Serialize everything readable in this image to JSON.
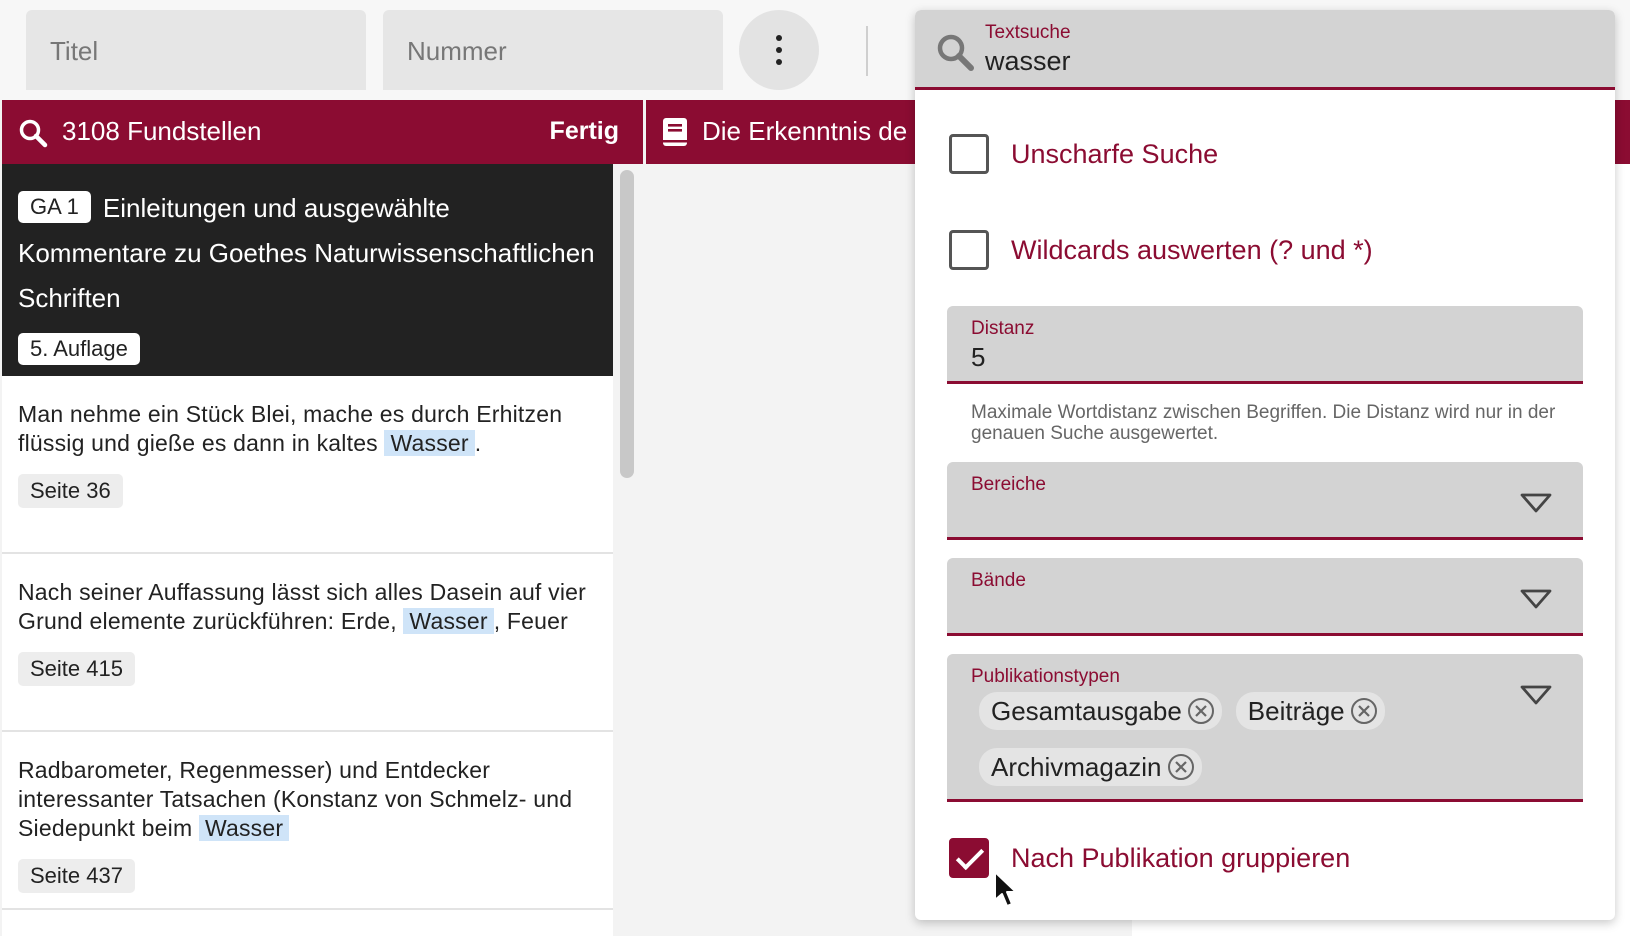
{
  "topbar": {
    "title_placeholder": "Titel",
    "number_placeholder": "Nummer"
  },
  "results_header": {
    "count": "3108 Fundstellen",
    "done_label": "Fertig"
  },
  "document_header": {
    "title": "Die Erkenntnis de"
  },
  "group": {
    "badge": "GA 1",
    "title": "Einleitungen und ausgewählte Kommentare zu Goethes Naturwissenschaftlichen Schriften",
    "edition": "5. Auflage"
  },
  "hits": [
    {
      "before": "Man nehme ein Stück Blei, mache es durch Erhitzen flüssig und gieße es dann in kaltes ",
      "match": "Wasser",
      "after": ".",
      "page": "Seite 36"
    },
    {
      "before": "Nach seiner Auffassung lässt sich alles Dasein auf vier Grund elemente zurückführen: Erde, ",
      "match": "Wasser",
      "after": ", Feuer",
      "page": "Seite 415"
    },
    {
      "before": "Radbarometer, Regenmesser) und Entdecker interessanter Tatsachen (Konstanz von Schmelz- und Siedepunkt beim ",
      "match": "Wasser",
      "after": "",
      "page": "Seite 437"
    }
  ],
  "search_panel": {
    "search_label": "Textsuche",
    "search_value": "wasser",
    "fuzzy": {
      "label": "Unscharfe Suche",
      "checked": false
    },
    "wildcards": {
      "label": "Wildcards auswerten (? und *)",
      "checked": false
    },
    "distance": {
      "label": "Distanz",
      "value": "5",
      "hint": "Maximale Wortdistanz zwischen Begriffen. Die Distanz wird nur in der genauen Suche ausgewertet."
    },
    "areas": {
      "label": "Bereiche"
    },
    "volumes": {
      "label": "Bände"
    },
    "pub_types": {
      "label": "Publikationstypen",
      "chips": [
        "Gesamtausgabe",
        "Beiträge",
        "Archivmagazin"
      ]
    },
    "group_by_pub": {
      "label": "Nach Publikation gruppieren",
      "checked": true
    }
  },
  "colors": {
    "accent": "#8b0c32",
    "highlight": "#cfe4f8"
  }
}
